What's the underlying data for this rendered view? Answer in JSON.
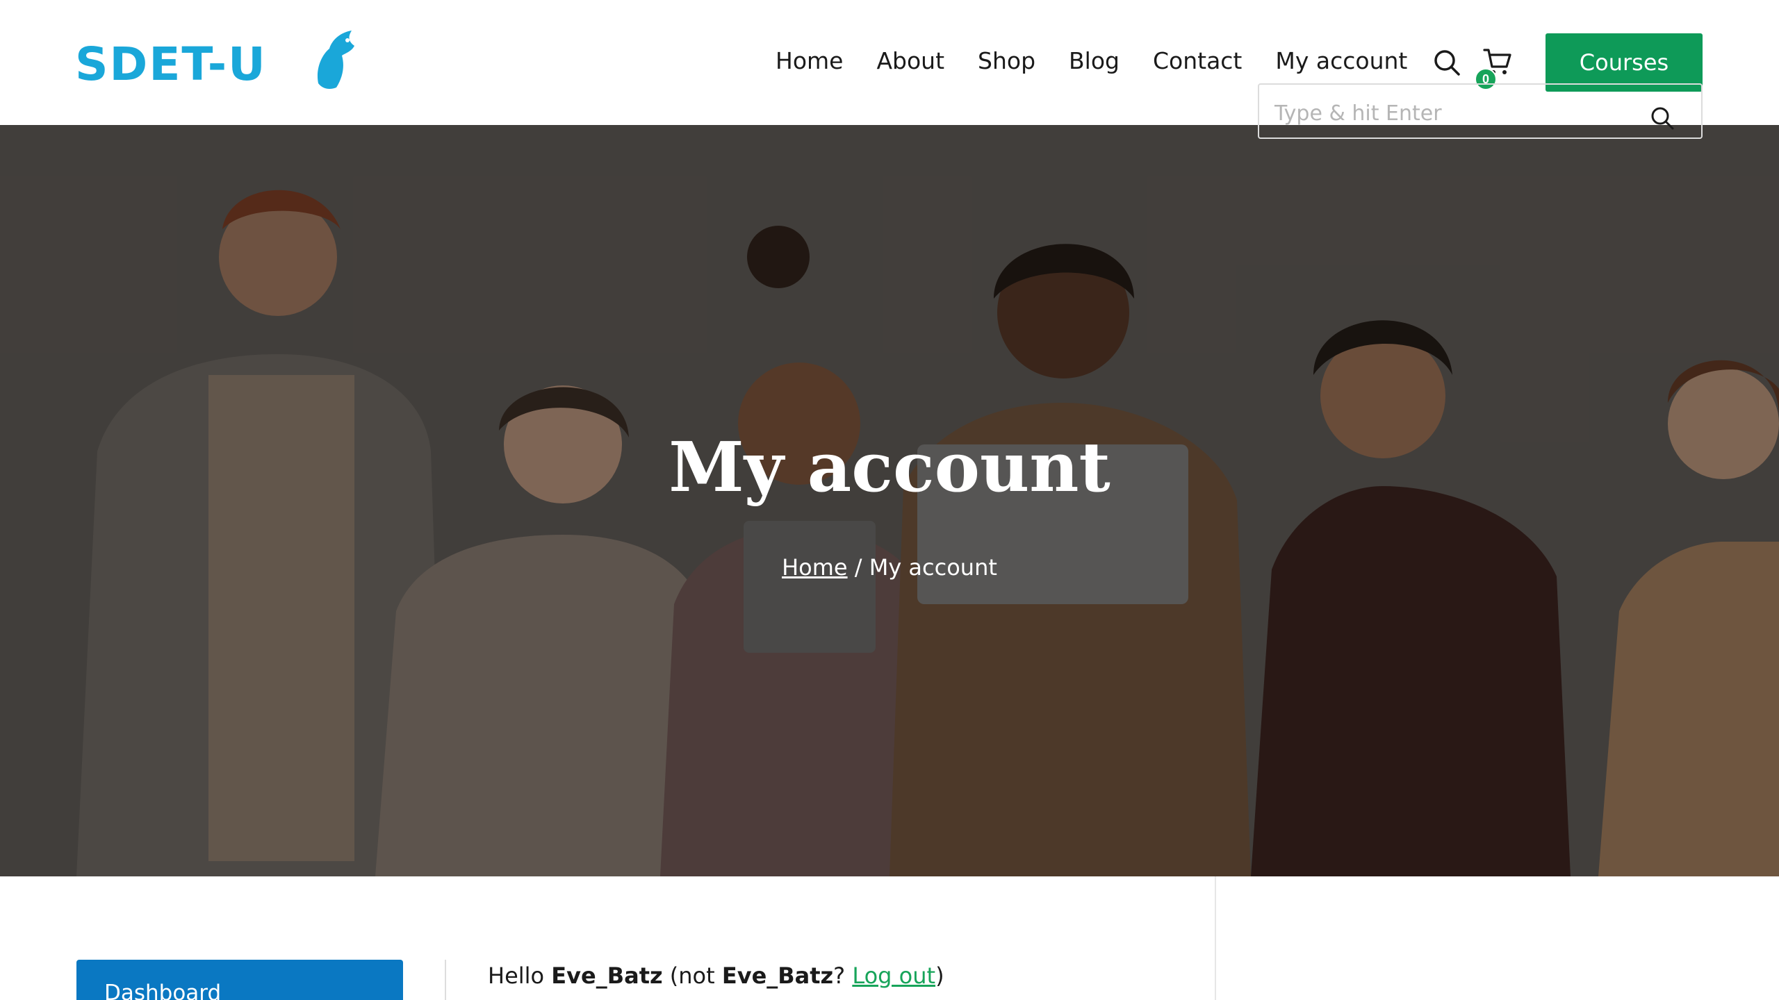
{
  "brand": {
    "logo_text": "SDET-U",
    "logo_color": "#1aa7d9"
  },
  "nav": {
    "items": [
      {
        "label": "Home"
      },
      {
        "label": "About"
      },
      {
        "label": "Shop"
      },
      {
        "label": "Blog"
      },
      {
        "label": "Contact"
      },
      {
        "label": "My account"
      }
    ],
    "search_icon": "search-icon",
    "cart_icon": "cart-icon",
    "cart_count": "0",
    "cta_label": "Courses",
    "cta_color": "#0e9a58"
  },
  "hero": {
    "title": "My account",
    "breadcrumb": {
      "home": "Home",
      "separator": " / ",
      "current": "My account"
    }
  },
  "account": {
    "menu": {
      "active_item": "Dashboard",
      "active_color": "#0a78c2"
    },
    "greeting": {
      "hello": "Hello ",
      "username": "Eve_Batz",
      "not_prefix": " (not ",
      "username_repeat": "Eve_Batz",
      "question": "? ",
      "logout": "Log out",
      "close_paren": ")"
    }
  },
  "sidebar": {
    "search_placeholder": "Type & hit Enter"
  }
}
